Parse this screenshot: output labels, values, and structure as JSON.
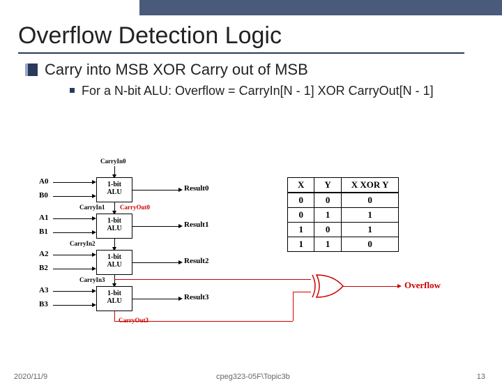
{
  "title": "Overflow Detection Logic",
  "bullet": "Carry into MSB XOR Carry out of MSB",
  "subbullet": "For a N-bit ALU: Overflow = CarryIn[N - 1] XOR CarryOut[N - 1]",
  "alu_label_line1": "1-bit",
  "alu_label_line2": "ALU",
  "inputs": {
    "a0": "A0",
    "b0": "B0",
    "a1": "A1",
    "b1": "B1",
    "a2": "A2",
    "b2": "B2",
    "a3": "A3",
    "b3": "B3"
  },
  "results": {
    "r0": "Result0",
    "r1": "Result1",
    "r2": "Result2",
    "r3": "Result3"
  },
  "carries": {
    "cin0": "CarryIn0",
    "cin1": "CarryIn1",
    "cout0": "CarryOut0",
    "cin2": "CarryIn2",
    "cin3": "CarryIn3",
    "cout3": "CarryOut3"
  },
  "overflow_label": "Overflow",
  "chart_data": {
    "type": "table",
    "title": "XOR truth table",
    "columns": [
      "X",
      "Y",
      "X XOR Y"
    ],
    "rows": [
      [
        0,
        0,
        0
      ],
      [
        0,
        1,
        1
      ],
      [
        1,
        0,
        1
      ],
      [
        1,
        1,
        0
      ]
    ]
  },
  "footer": {
    "left": "2020/11/9",
    "mid": "cpeg323-05F\\Topic3b",
    "right": "13"
  }
}
